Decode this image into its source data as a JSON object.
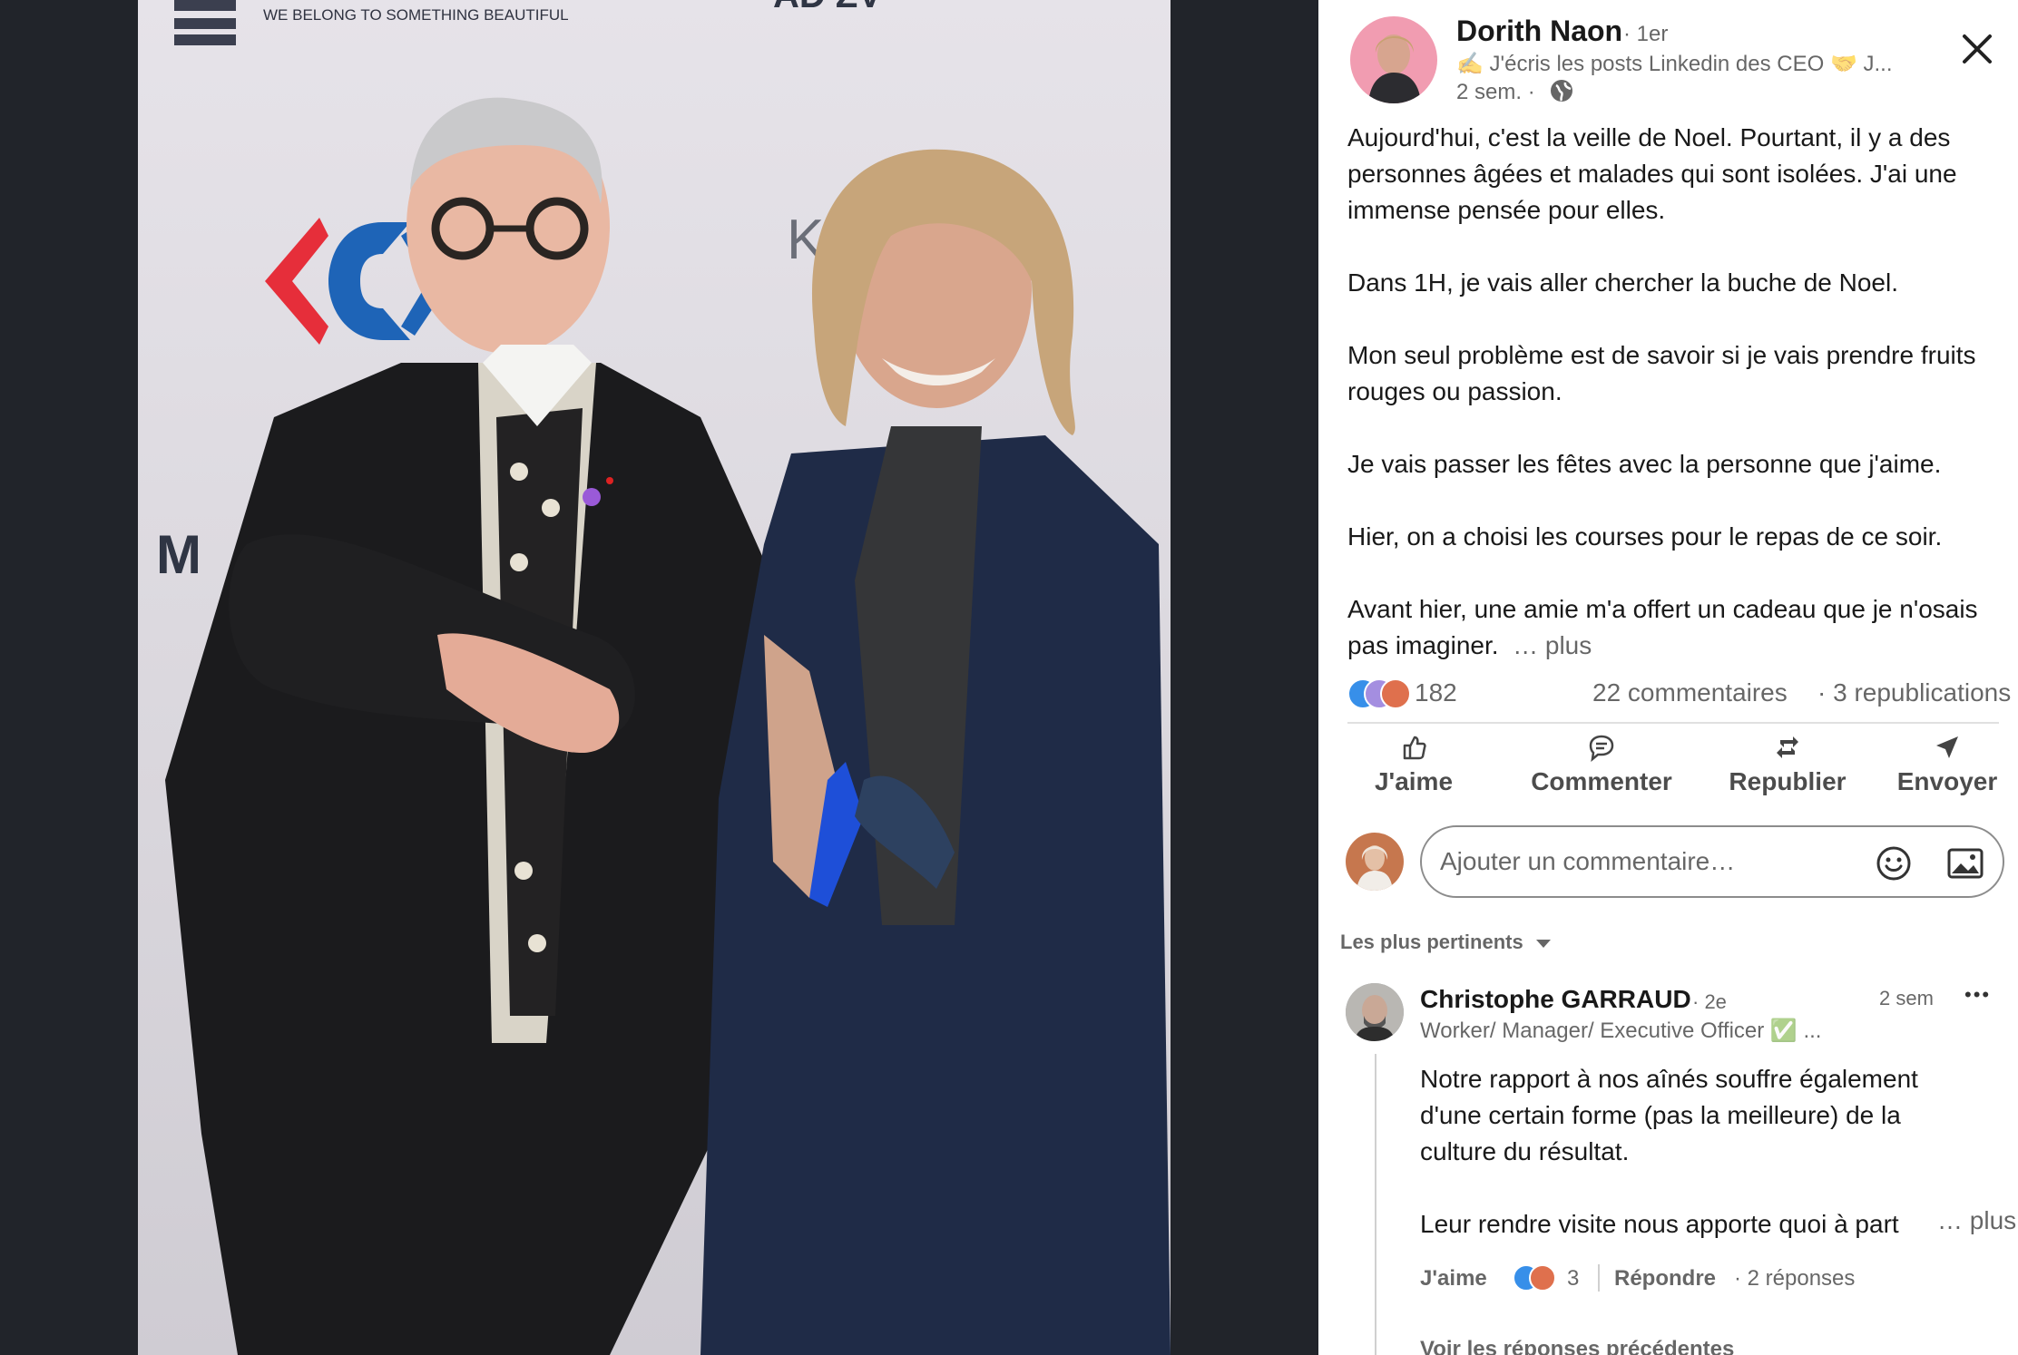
{
  "photo": {
    "backdrop_tagline": "WE BELONG TO SOMETHING BEAUTIFUL",
    "backdrop_word": "K  NG"
  },
  "close_icon": "close-icon",
  "post": {
    "author": {
      "name": "Dorith Naon",
      "degree": "· 1er",
      "headline": "✍️ J'écris les posts Linkedin des CEO 🤝 J...",
      "time": "2 sem. ·",
      "visibility_icon": "globe-icon"
    },
    "body_lines": [
      "Aujourd'hui, c'est la veille de Noel. Pourtant, il y a des",
      "personnes âgées et malades qui sont isolées. J'ai une",
      "immense pensée pour elles.",
      "",
      "Dans 1H, je vais aller chercher la buche de Noel.",
      "",
      "Mon seul problème est de savoir si je vais prendre fruits",
      "rouges ou passion.",
      "",
      "Je vais passer les fêtes avec la personne que j'aime.",
      "",
      "Hier, on a choisi les courses pour le repas de ce soir.",
      "",
      "Avant hier, une amie m'a offert un cadeau que je n'osais",
      "pas imaginer."
    ],
    "more_label": "… plus",
    "reactions_count": "182",
    "comments_count": "22 commentaires",
    "reposts_count": "· 3 republications"
  },
  "actions": {
    "like": "J'aime",
    "comment": "Commenter",
    "repost": "Republier",
    "send": "Envoyer"
  },
  "comment_input": {
    "placeholder": "Ajouter un commentaire…",
    "emoji_icon": "emoji-icon",
    "image_icon": "image-icon"
  },
  "sort": {
    "label": "Les plus pertinents"
  },
  "comment": {
    "author": "Christophe GARRAUD",
    "degree": "· 2e",
    "headline": "Worker/ Manager/ Executive Officer ✅ ...",
    "time": "2 sem",
    "menu": "•••",
    "body_lines": [
      "Notre rapport à nos aînés souffre également",
      "d'une certain forme (pas la meilleure) de la",
      "culture du résultat.",
      "",
      "Leur rendre visite nous apporte quoi à part"
    ],
    "more_label": "… plus",
    "like_label": "J'aime",
    "reaction_count": "3",
    "reply_label": "Répondre",
    "replies_count": "· 2 réponses",
    "previous_replies": "Voir les réponses précédentes"
  },
  "colors": {
    "linkedin_blue": "#0a66c2",
    "like_blue": "#378fe9",
    "heart_red": "#df704d",
    "jacket_navy": "#1f2b47"
  }
}
